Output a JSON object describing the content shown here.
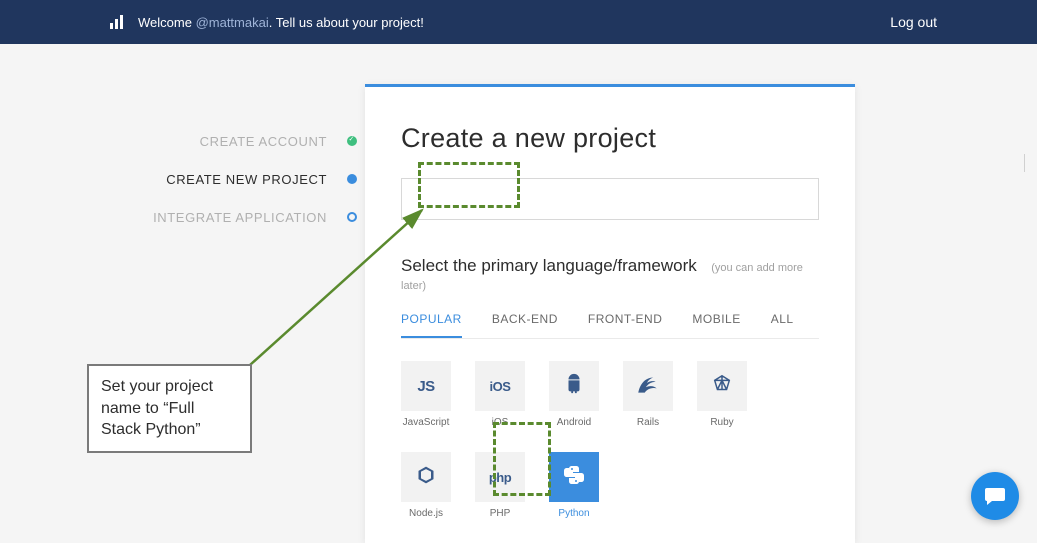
{
  "topbar": {
    "welcome_prefix": "Welcome ",
    "handle": "@mattmakai",
    "welcome_suffix": ". Tell us about your project!",
    "logout": "Log out"
  },
  "steps": {
    "items": [
      {
        "label": "CREATE ACCOUNT"
      },
      {
        "label": "CREATE NEW PROJECT"
      },
      {
        "label": "INTEGRATE APPLICATION"
      }
    ]
  },
  "card": {
    "title": "Create a new project",
    "project_value": "",
    "framework_label": "Select the primary language/framework",
    "framework_hint": "(you can add more later)"
  },
  "tabs": {
    "items": [
      {
        "label": "POPULAR"
      },
      {
        "label": "BACK-END"
      },
      {
        "label": "FRONT-END"
      },
      {
        "label": "MOBILE"
      },
      {
        "label": "ALL"
      }
    ]
  },
  "tiles": {
    "row1": [
      {
        "name": "javascript",
        "label": "JavaScript",
        "glyph": "JS"
      },
      {
        "name": "ios",
        "label": "iOS",
        "glyph": "iOS"
      },
      {
        "name": "android",
        "label": "Android",
        "glyph": ""
      },
      {
        "name": "rails",
        "label": "Rails",
        "glyph": ""
      },
      {
        "name": "ruby",
        "label": "Ruby",
        "glyph": ""
      },
      {
        "name": "nodejs",
        "label": "Node.js",
        "glyph": ""
      }
    ],
    "row2": [
      {
        "name": "php",
        "label": "PHP",
        "glyph": "php"
      },
      {
        "name": "python",
        "label": "Python",
        "glyph": ""
      }
    ]
  },
  "callout": {
    "text": "Set your project name to “Full Stack Python”"
  }
}
